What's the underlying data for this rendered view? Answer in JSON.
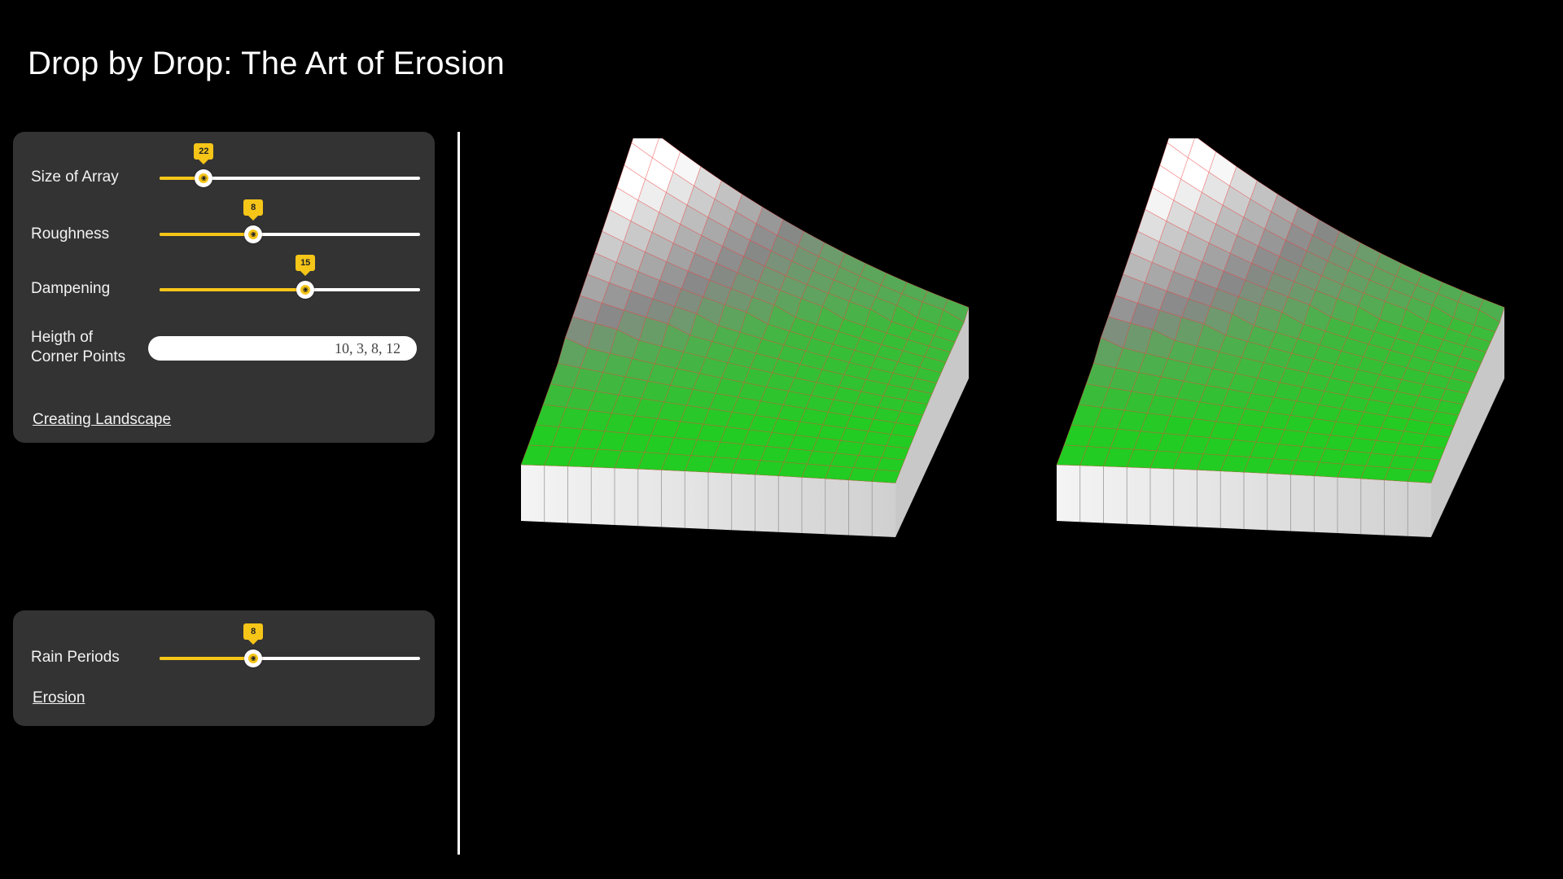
{
  "title": "Drop by Drop: The Art of Erosion",
  "landscape_panel": {
    "size_of_array": {
      "label": "Size of Array",
      "value": "22",
      "fraction": 0.17
    },
    "roughness": {
      "label": "Roughness",
      "value": "8",
      "fraction": 0.36
    },
    "dampening": {
      "label": "Dampening",
      "value": "15",
      "fraction": 0.56
    },
    "corner_points": {
      "label_line1": "Heigth of",
      "label_line2": "Corner Points",
      "value": "10, 3, 8, 12"
    },
    "action_link": "Creating Landscape"
  },
  "erosion_panel": {
    "rain_periods": {
      "label": "Rain Periods",
      "value": "8",
      "fraction": 0.36
    },
    "action_link": "Erosion"
  },
  "colors": {
    "accent": "#f5c518",
    "panel_bg": "#333333",
    "terrain_low": "#22cc22",
    "terrain_high": "#ffffff",
    "mesh_lines": "#ff4444"
  },
  "icons": {
    "slider_thumb": "eye-icon"
  }
}
